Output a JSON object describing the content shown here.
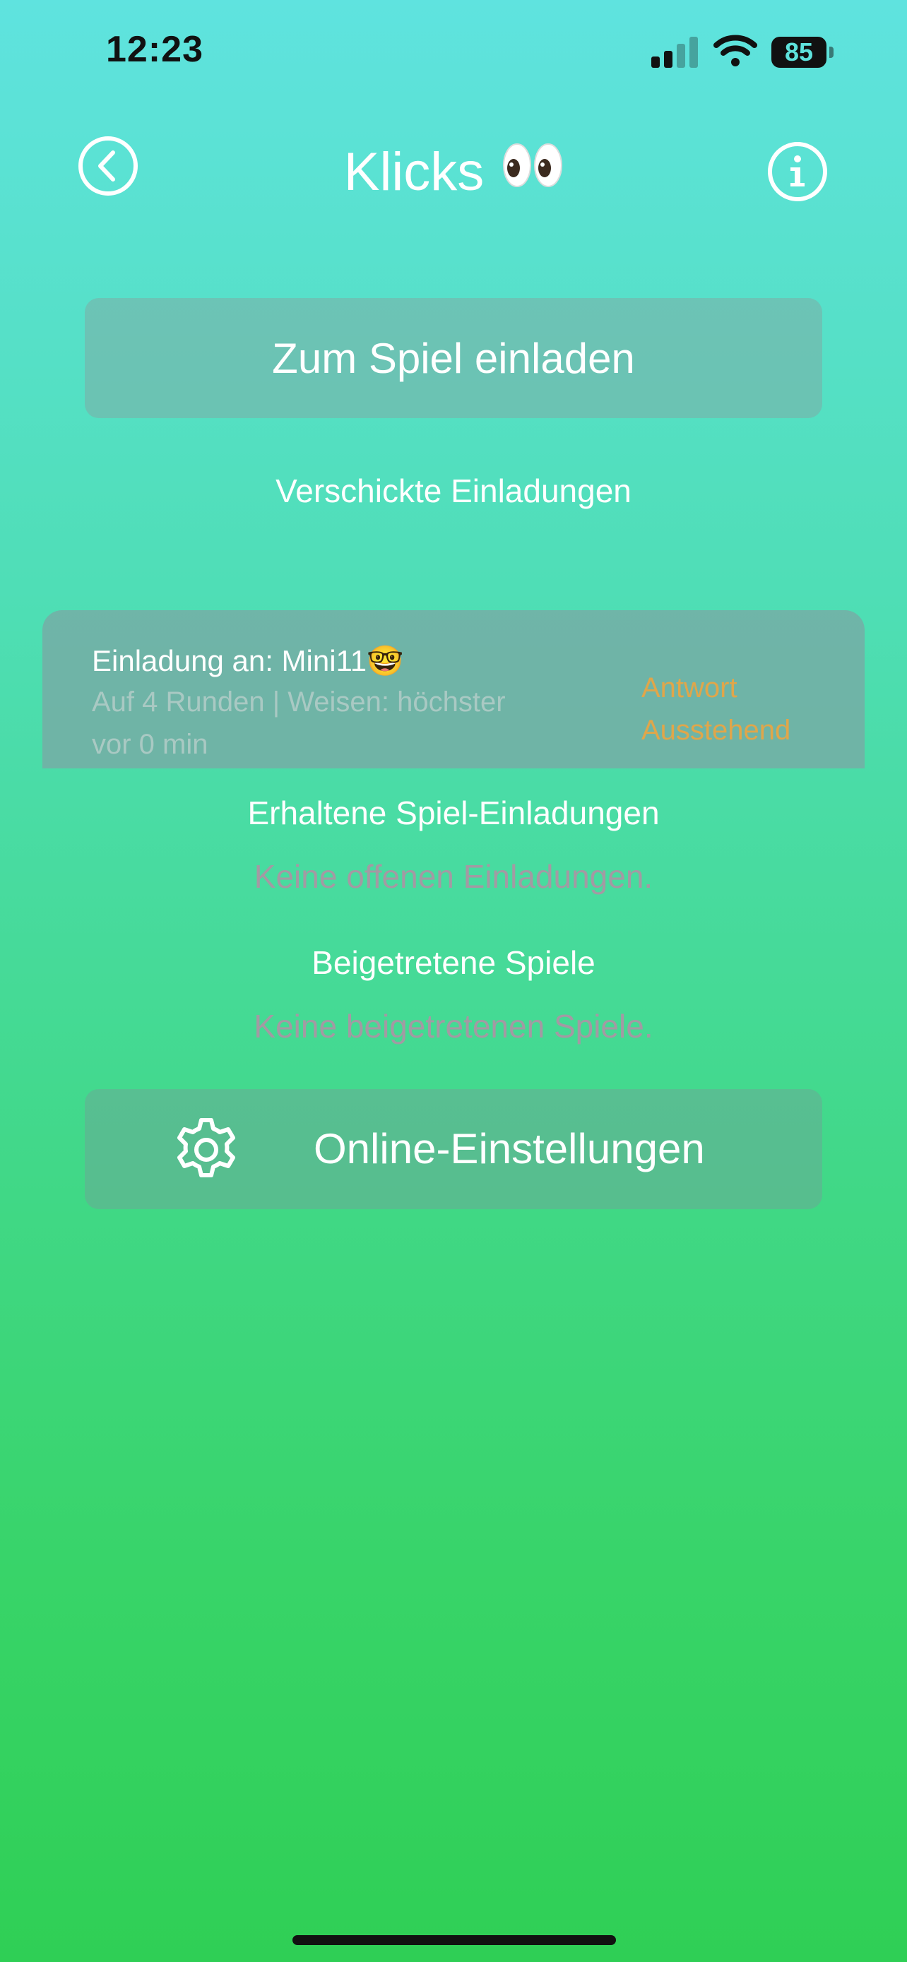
{
  "status_bar": {
    "time": "12:23",
    "battery": "85"
  },
  "header": {
    "title": "Klicks",
    "title_emoji": "eyes-emoji"
  },
  "invite_button": {
    "label": "Zum Spiel einladen"
  },
  "sent_invitations": {
    "heading": "Verschickte Einladungen",
    "items": [
      {
        "title": "Einladung an: Mini11🤓",
        "details": "Auf 4 Runden | Weisen: höchster",
        "time": "vor 0 min",
        "status_line1": "Antwort",
        "status_line2": "Ausstehend"
      }
    ]
  },
  "received_invitations": {
    "heading": "Erhaltene Spiel-Einladungen",
    "empty_text": "Keine offenen Einladungen."
  },
  "joined_games": {
    "heading": "Beigetretene Spiele",
    "empty_text": "Keine beigetretenen Spiele."
  },
  "settings_button": {
    "label": "Online-Einstellungen"
  },
  "colors": {
    "gradient_top": "#5fe3df",
    "gradient_bottom": "#2fcf55",
    "pending_status": "#e0a64a",
    "muted_text": "#a39aa3"
  }
}
